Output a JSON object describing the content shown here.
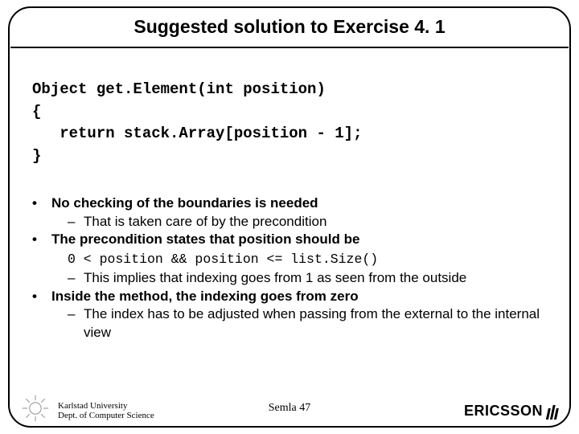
{
  "title": "Suggested solution to Exercise 4. 1",
  "code": {
    "line1": "Object get.Element(int position)",
    "line2": "{",
    "line3": "   return stack.Array[position - 1];",
    "line4": "}"
  },
  "bullets": {
    "b1a": "No checking of the boundaries is needed",
    "b1a_sub1": "That is taken care of by the precondition",
    "b1b": "The precondition states that position should be",
    "precond_code": "0 < position && position <= list.Size()",
    "b1b_sub1": "This implies that indexing goes from 1 as seen from the outside",
    "b1c": "Inside the method, the indexing goes from zero",
    "b1c_sub1": "The index has to be adjusted when passing from the external to the internal view"
  },
  "footer": {
    "left_line1": "Karlstad University",
    "left_line2": "Dept. of Computer Science",
    "center": "Semla 47",
    "right_brand": "ERICSSON"
  }
}
